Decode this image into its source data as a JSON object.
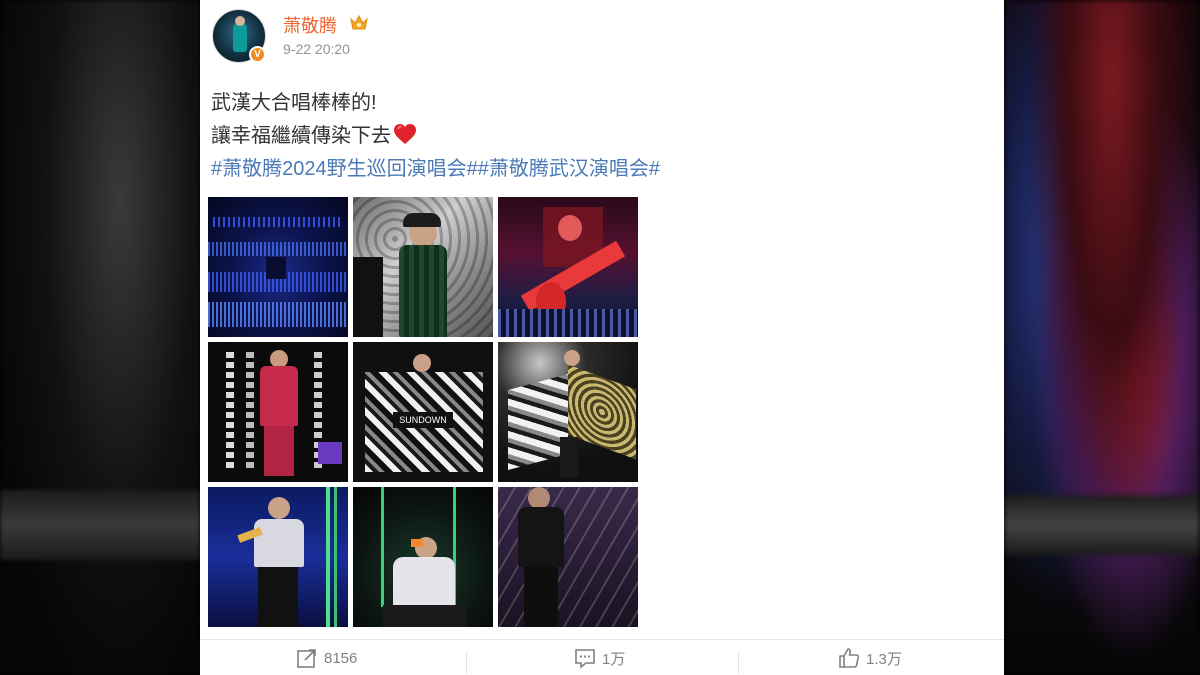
{
  "post": {
    "username": "萧敬腾",
    "timestamp": "9-22 20:20",
    "verified_badge": "V",
    "text_line1": "武漢大合唱棒棒的!",
    "text_line2": "讓幸福繼續傳染下去",
    "hashtag1": "#萧敬腾2024野生巡回演唱会#",
    "hashtag2": "#萧敬腾武汉演唱会#",
    "photos": [
      {
        "name": "photo-crowd-blue-lights"
      },
      {
        "name": "photo-green-plaid-suit"
      },
      {
        "name": "photo-red-guitar-screen"
      },
      {
        "name": "photo-pink-suit-stage"
      },
      {
        "name": "photo-black-white-cape"
      },
      {
        "name": "photo-cape-leopard"
      },
      {
        "name": "photo-white-jacket-blue"
      },
      {
        "name": "photo-white-jacket-kneeling"
      },
      {
        "name": "photo-black-outfit-confetti"
      }
    ]
  },
  "actions": {
    "repost_count": "8156",
    "comment_count": "1万",
    "like_count": "1.3万"
  },
  "icons": {
    "crown": "crown-icon",
    "heart": "red-heart-icon",
    "repost": "repost-icon",
    "comment": "comment-icon",
    "like": "thumbs-up-icon"
  },
  "colors": {
    "username": "#f1642f",
    "hashtag": "#4b7ab7",
    "text": "#333333",
    "muted": "#939393"
  }
}
